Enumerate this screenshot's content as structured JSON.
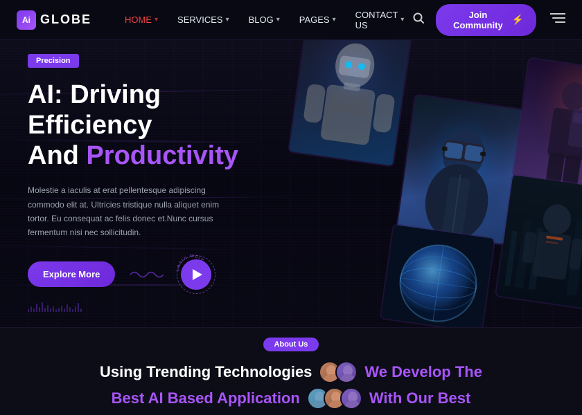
{
  "logo": {
    "icon_text": "Ai",
    "text": "GLOBE"
  },
  "navbar": {
    "home_label": "HOME",
    "services_label": "SERVICES",
    "blog_label": "BLOG",
    "pages_label": "PAGES",
    "contact_label": "CONTACT US",
    "join_btn_label": "Join Community",
    "join_btn_icon": "⚡"
  },
  "hero": {
    "badge_label": "Precision",
    "title_line1": "AI: Driving Efficiency",
    "title_line2_plain": "And ",
    "title_line2_highlight": "Productivity",
    "description": "Molestie a iaculis at erat pellentesque adipiscing commodo elit at. Ultricies tristique nulla aliquet enim tortor. Eu consequat ac felis donec et.Nunc cursus fermentum nisi nec sollicitudin.",
    "explore_btn_label": "Explore More",
    "video_learn_text": "Learn More"
  },
  "about": {
    "badge_label": "About Us",
    "line1_plain": "Using Trending Technologies",
    "line1_highlight": "We Develop The",
    "line2_plain": "Best AI Based Application",
    "line2_highlight": "With Our Best"
  },
  "colors": {
    "accent": "#7c3aed",
    "highlight": "#a855f7",
    "nav_active": "#ef4444",
    "bg_dark": "#080810",
    "bg_darker": "#0d0d18"
  }
}
